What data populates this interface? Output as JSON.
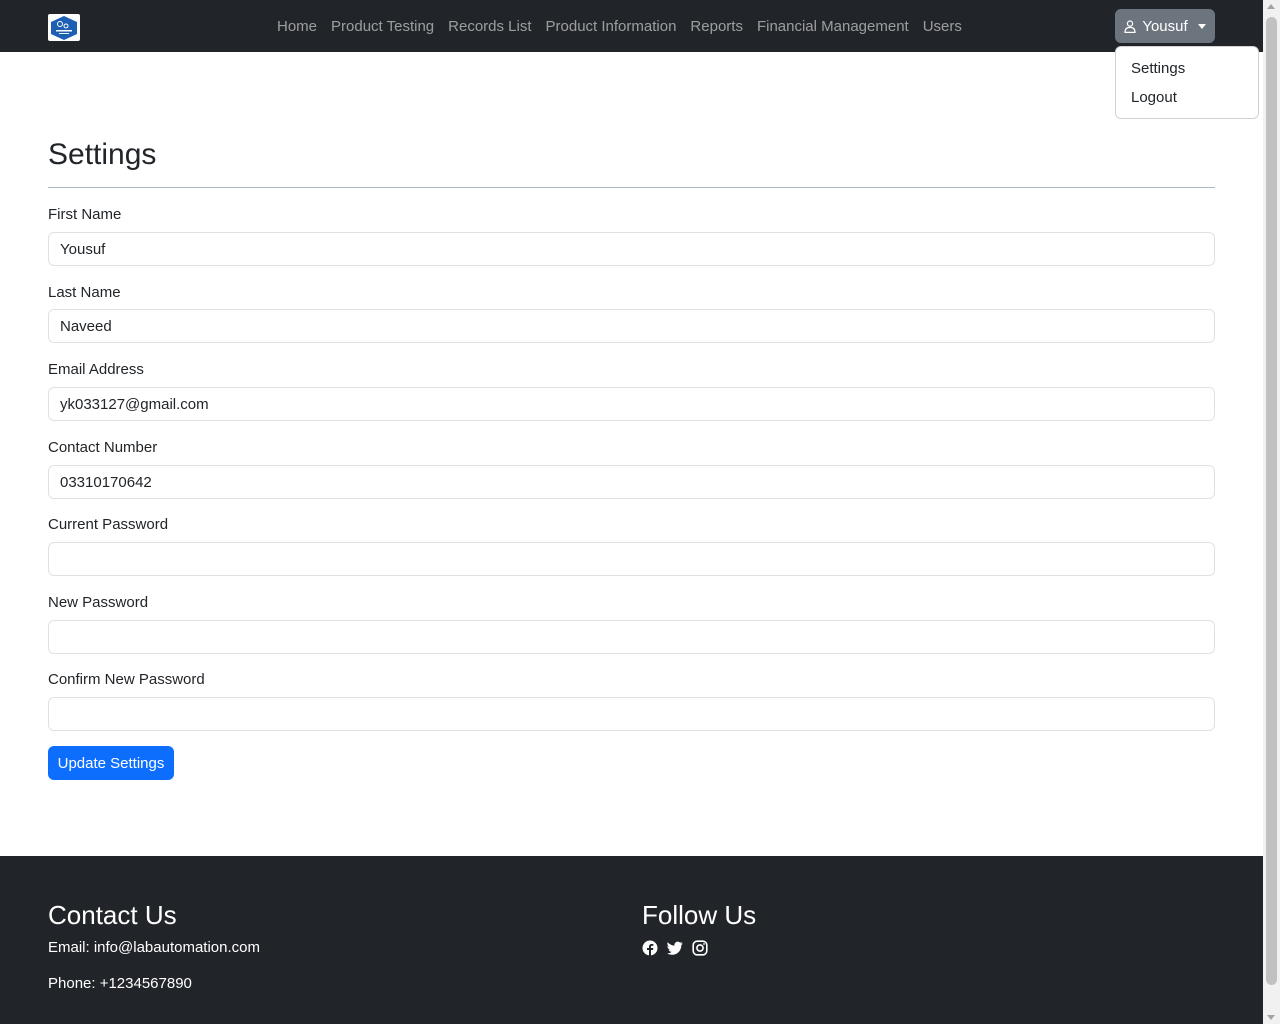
{
  "navbar": {
    "logo_icon": "lab-automation-logo",
    "links": [
      "Home",
      "Product Testing",
      "Records List",
      "Product Information",
      "Reports",
      "Financial Management",
      "Users"
    ],
    "user": {
      "icon": "person-icon",
      "name": "Yousuf"
    },
    "dropdown": [
      "Settings",
      "Logout"
    ]
  },
  "main": {
    "title": "Settings",
    "fields": [
      {
        "label": "First Name",
        "value": "Yousuf"
      },
      {
        "label": "Last Name",
        "value": "Naveed"
      },
      {
        "label": "Email Address",
        "value": "yk033127@gmail.com"
      },
      {
        "label": "Contact Number",
        "value": "03310170642"
      },
      {
        "label": "Current Password",
        "value": ""
      },
      {
        "label": "New Password",
        "value": ""
      },
      {
        "label": "Confirm New Password",
        "value": ""
      }
    ],
    "submit_label": "Update Settings"
  },
  "footer": {
    "contact": {
      "heading": "Contact Us",
      "email": "Email: info@labautomation.com",
      "phone": "Phone: +1234567890"
    },
    "follow": {
      "heading": "Follow Us",
      "icons": [
        "facebook-icon",
        "twitter-icon",
        "instagram-icon"
      ]
    }
  },
  "colors": {
    "navbar_bg": "#212529",
    "primary": "#0d6efd",
    "secondary": "#6c757d",
    "footer_bg": "#212529"
  }
}
